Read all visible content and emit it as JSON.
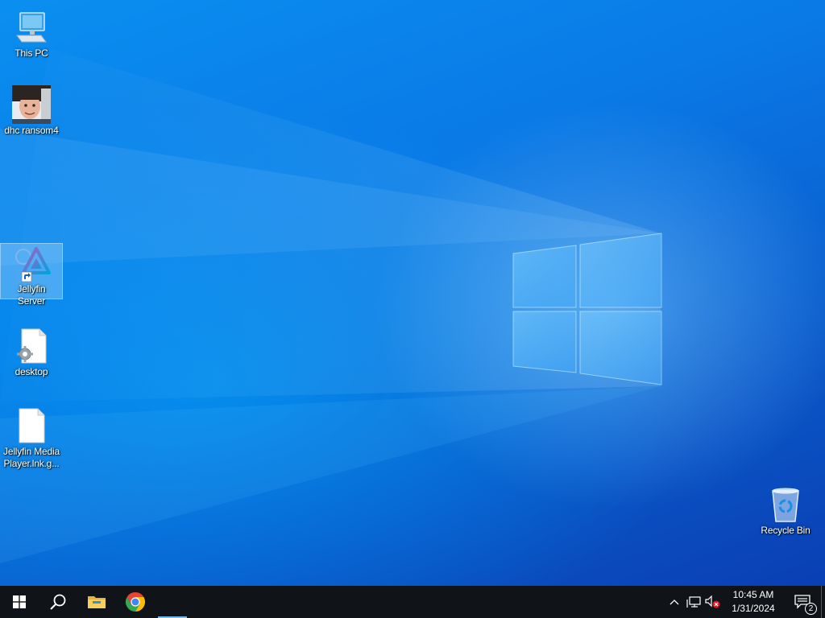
{
  "desktop": {
    "icons": [
      {
        "label": "This PC",
        "icon": "computer-icon"
      },
      {
        "label": "dhc ransom4",
        "icon": "photo-thumbnail-icon"
      },
      {
        "label": "Jellyfin Server",
        "icon": "jellyfin-shortcut-icon",
        "selected": true
      },
      {
        "label": "desktop",
        "icon": "settings-file-icon"
      },
      {
        "label": "Jellyfin Media Player.lnk.g...",
        "icon": "blank-file-icon"
      },
      {
        "label": "Recycle Bin",
        "icon": "recycle-bin-icon"
      }
    ]
  },
  "taskbar": {
    "start": "windows-logo-icon",
    "search": "search-icon",
    "pinned": [
      {
        "name": "File Explorer",
        "icon": "folder-icon"
      },
      {
        "name": "Google Chrome",
        "icon": "chrome-icon"
      }
    ],
    "tray": {
      "time": "10:45 AM",
      "date": "1/31/2024",
      "notification_count": "2"
    }
  },
  "colors": {
    "taskbar": "#101418",
    "accent": "#76b9ed",
    "wallpaper": "#0a7ae6"
  }
}
